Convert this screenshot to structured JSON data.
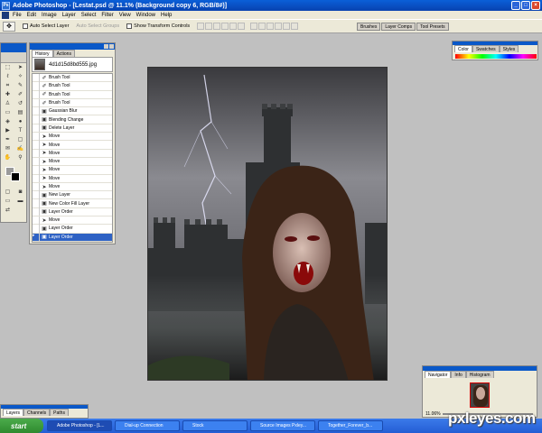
{
  "window": {
    "title": "Adobe Photoshop - [Lestat.psd @ 11.1% (Background copy 6, RGB/8#)]",
    "controls": [
      "_",
      "□",
      "×"
    ]
  },
  "menubar": {
    "items": [
      "File",
      "Edit",
      "Image",
      "Layer",
      "Select",
      "Filter",
      "View",
      "Window",
      "Help"
    ]
  },
  "options": {
    "auto_select_layer": "Auto Select Layer",
    "auto_select_groups": "Auto Select Groups",
    "show_transform_controls": "Show Transform Controls",
    "palette_well_tabs": [
      "Brushes",
      "Layer Comps",
      "Tool Presets"
    ]
  },
  "history": {
    "tabs": [
      "History",
      "Actions"
    ],
    "snapshot": "4d1d15d8bd555.jpg",
    "items": [
      {
        "label": "Brush Tool",
        "icon": "brush-icon"
      },
      {
        "label": "Brush Tool",
        "icon": "brush-icon"
      },
      {
        "label": "Brush Tool",
        "icon": "brush-icon"
      },
      {
        "label": "Brush Tool",
        "icon": "brush-icon"
      },
      {
        "label": "Gaussian Blur",
        "icon": "step-icon"
      },
      {
        "label": "Blending Change",
        "icon": "step-icon"
      },
      {
        "label": "Delete Layer",
        "icon": "step-icon"
      },
      {
        "label": "Move",
        "icon": "move-icon"
      },
      {
        "label": "Move",
        "icon": "move-icon"
      },
      {
        "label": "Move",
        "icon": "move-icon"
      },
      {
        "label": "Move",
        "icon": "move-icon"
      },
      {
        "label": "Move",
        "icon": "move-icon"
      },
      {
        "label": "Move",
        "icon": "move-icon"
      },
      {
        "label": "Move",
        "icon": "move-icon"
      },
      {
        "label": "New Layer",
        "icon": "step-icon"
      },
      {
        "label": "New Color Fill Layer",
        "icon": "step-icon"
      },
      {
        "label": "Layer Order",
        "icon": "step-icon"
      },
      {
        "label": "Move",
        "icon": "move-icon"
      },
      {
        "label": "Layer Order",
        "icon": "step-icon"
      },
      {
        "label": "Layer Order",
        "icon": "step-icon",
        "selected": true
      }
    ]
  },
  "color_palette": {
    "tabs": [
      "Color",
      "Swatches",
      "Styles"
    ]
  },
  "navigator": {
    "tabs": [
      "Navigator",
      "Info",
      "Histogram"
    ],
    "zoom": "11.06%"
  },
  "layers_palette": {
    "tabs": [
      "Layers",
      "Channels",
      "Paths"
    ]
  },
  "taskbar": {
    "start": "start",
    "tasks": [
      "Adobe Photoshop - [L...",
      "Dial-up Connection",
      "Stock",
      "Source Images Pxley...",
      "Together_Forever_b..."
    ]
  },
  "watermark": "pxleyes.com"
}
